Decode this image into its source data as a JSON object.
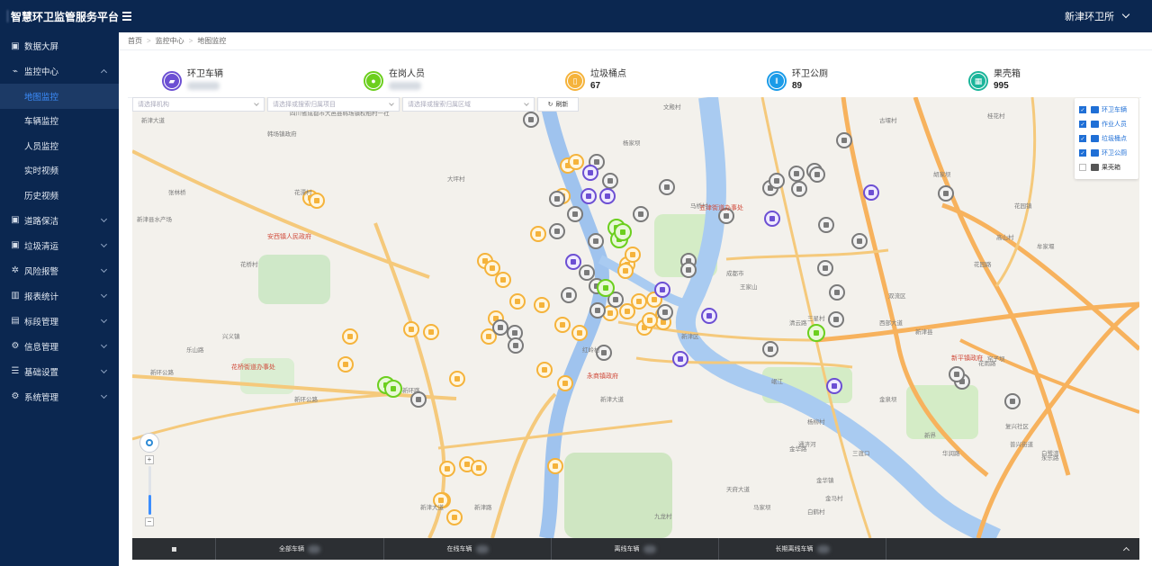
{
  "header": {
    "app_title": "智慧环卫监管服务平台",
    "station": "新津环卫所"
  },
  "sidebar": {
    "items": [
      {
        "label": "数据大屏",
        "icon": "monitor-icon"
      },
      {
        "label": "监控中心",
        "icon": "chart-line-icon",
        "expanded": true,
        "children": [
          "地图监控",
          "车辆监控",
          "人员监控",
          "实时视频",
          "历史视频"
        ],
        "active_child": "地图监控"
      },
      {
        "label": "道路保洁",
        "icon": "monitor-icon"
      },
      {
        "label": "垃圾清运",
        "icon": "monitor-icon"
      },
      {
        "label": "风险报警",
        "icon": "gear-icon"
      },
      {
        "label": "报表统计",
        "icon": "bar-chart-icon"
      },
      {
        "label": "标段管理",
        "icon": "image-icon"
      },
      {
        "label": "信息管理",
        "icon": "settings-icon"
      },
      {
        "label": "基础设置",
        "icon": "list-icon"
      },
      {
        "label": "系统管理",
        "icon": "settings-icon"
      }
    ]
  },
  "breadcrumb": [
    "首页",
    "监控中心",
    "地图监控"
  ],
  "stats": [
    {
      "label": "环卫车辆",
      "value": "",
      "color": "#6c4fd3",
      "icon": "truck-icon"
    },
    {
      "label": "在岗人员",
      "value": "",
      "color": "#6ccf1e",
      "icon": "person-icon"
    },
    {
      "label": "垃圾桶点",
      "value": "67",
      "color": "#f5b33b",
      "icon": "trash-bin-icon"
    },
    {
      "label": "环卫公厕",
      "value": "89",
      "color": "#1a9be8",
      "icon": "toilet-icon"
    },
    {
      "label": "果壳箱",
      "value": "995",
      "color": "#1bb59a",
      "icon": "box-icon"
    }
  ],
  "filters": {
    "org_placeholder": "请选择机构",
    "project_placeholder": "请选择或搜索归属项目",
    "area_placeholder": "请选择或搜索归属区域",
    "refresh_label": "刷新"
  },
  "legend": [
    {
      "label": "环卫车辆",
      "checked": true
    },
    {
      "label": "作业人员",
      "checked": true
    },
    {
      "label": "垃圾桶点",
      "checked": true
    },
    {
      "label": "环卫公厕",
      "checked": true
    },
    {
      "label": "果壳箱",
      "checked": false
    }
  ],
  "map": {
    "labels": [
      "新津大道",
      "新环公路",
      "新环公路",
      "新津大道",
      "西部大道",
      "花园路",
      "新环路",
      "新津路",
      "通济河",
      "天府大道",
      "三渡口",
      "新界",
      "文殿村",
      "桂花村",
      "新津区",
      "花雨路",
      "四川省成都市大邑县韩场镇权柏村一社",
      "韩场镇政府",
      "花漂村",
      "花桥村",
      "张林桥",
      "新津县水产场",
      "兴义镇",
      "三星村",
      "乐山路",
      "成都市",
      "双流区",
      "新津县",
      "华润路",
      "金华路",
      "金华镇",
      "普兴街道",
      "白鹤村",
      "岷江",
      "清云路",
      "红岭村",
      "复兴社区",
      "新津大道",
      "杨柳村",
      "金泉坝",
      "王家山",
      "高山村",
      "牟家堰",
      "马桥村",
      "古堰村",
      "胡家坝",
      "金马村",
      "马家坝",
      "杨家坝",
      "大坪村",
      "九龙村",
      "花园镇",
      "窑子坝",
      "永乐路",
      "白鹭湾"
    ],
    "district_1": "五津街道办事处",
    "district_2": "安西镇人民政府",
    "district_3": "花桥街道办事处",
    "district_4": "新平镇政府",
    "district_5": "永商镇政府",
    "zoom_in": "+",
    "zoom_out": "−"
  },
  "bottom": {
    "all_vehicles": "全部车辆",
    "online_vehicles": "在线车辆",
    "offline_vehicles": "离线车辆",
    "long_offline_vehicles": "长期离线车辆"
  }
}
